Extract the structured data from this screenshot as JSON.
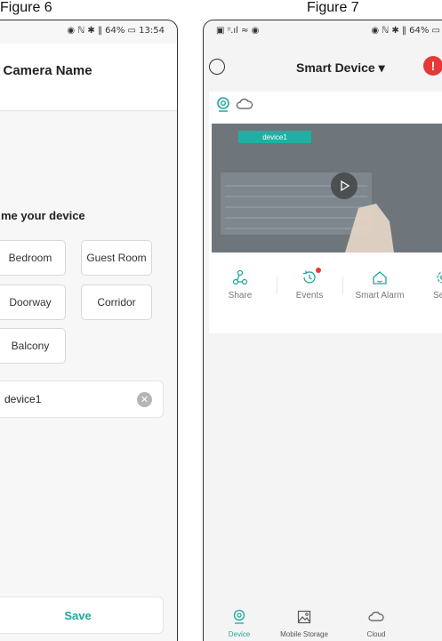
{
  "figure6": {
    "caption": "Figure 6",
    "status": "◉ ℕ ✱ ‖ 64% ▭ 13:54",
    "header_title": "a Camera Name",
    "prompt": "me your device",
    "rooms": [
      "Bedroom",
      "Guest Room",
      "Doorway",
      "Corridor",
      "Balcony"
    ],
    "device_name_value": "device1",
    "save_label": "Save"
  },
  "figure7": {
    "caption": "Figure 7",
    "status_left": "▣ ᵎᵎ.ıl ≈ ◉",
    "status_right": "◉ ℕ ✱ ‖ 64% ▭",
    "title": "Smart Device ▾",
    "alert_symbol": "!",
    "video_device_label": "device1",
    "actions": [
      "Share",
      "Events",
      "Smart Alarm",
      "Setti"
    ],
    "nav": [
      "Device",
      "Mobile Storage",
      "Cloud"
    ]
  },
  "colors": {
    "accent": "#1ea89a",
    "alert": "#e53935"
  }
}
